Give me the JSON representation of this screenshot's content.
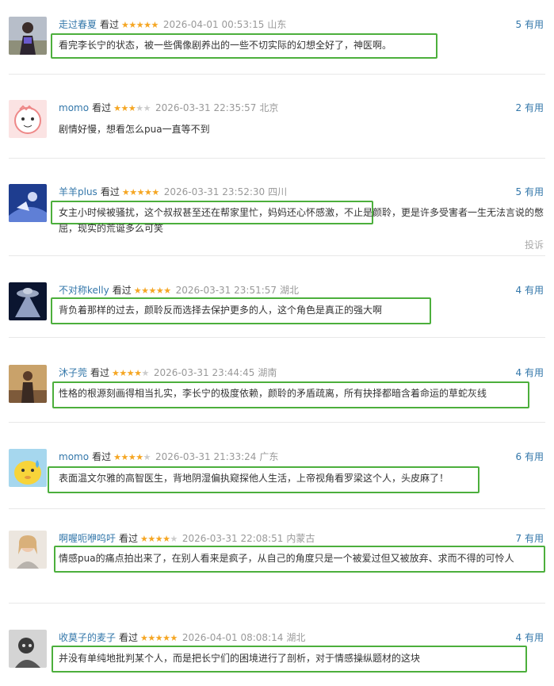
{
  "action_label": "看过",
  "useful_suffix": "有用",
  "report_label": "投诉",
  "colors": {
    "user": "#3377aa",
    "star": "#f5a623",
    "highlight": "#4caf3c",
    "meta": "#999999"
  },
  "comments": [
    {
      "user": "走过春夏",
      "rating": 5,
      "time": "2026-04-01 00:53:15",
      "location": "山东",
      "useful": "5",
      "text": "看完李长宁的状态，被一些偶像剧养出的一些不切实际的幻想全好了，神医啊。"
    },
    {
      "user": "momo",
      "rating": 3,
      "time": "2026-03-31 22:35:57",
      "location": "北京",
      "useful": "2",
      "text": "剧情好慢，想看怎么pua一直等不到"
    },
    {
      "user": "羊羊plus",
      "rating": 5,
      "time": "2026-03-31 23:52:30",
      "location": "四川",
      "useful": "5",
      "text": "女主小时候被骚扰，这个叔叔甚至还在帮家里忙，妈妈还心怀感激，不止是颜聆，更是许多受害者一生无法言说的憋屈，现实的荒诞多么可笑"
    },
    {
      "user": "不对称kelly",
      "rating": 5,
      "time": "2026-03-31 23:51:57",
      "location": "湖北",
      "useful": "4",
      "text": "背负着那样的过去，颜聆反而选择去保护更多的人，这个角色是真正的强大啊"
    },
    {
      "user": "沐子莞",
      "rating": 4,
      "time": "2026-03-31 23:44:45",
      "location": "湖南",
      "useful": "4",
      "text": "性格的根源刻画得相当扎实，李长宁的极度依赖，颜聆的矛盾疏离，所有抉择都暗含着命运的草蛇灰线"
    },
    {
      "user": "momo",
      "rating": 4,
      "time": "2026-03-31 21:33:24",
      "location": "广东",
      "useful": "6",
      "text": "表面温文尔雅的高智医生，背地阴湿偏执窥探他人生活，上帝视角看罗梁这个人，头皮麻了！"
    },
    {
      "user": "啊喔呃咿呜吁",
      "rating": 4,
      "time": "2026-03-31 22:08:51",
      "location": "内蒙古",
      "useful": "7",
      "text": "情感pua的痛点拍出来了，在别人看来是疯子，从自己的角度只是一个被爱过但又被放弃、求而不得的可怜人"
    },
    {
      "user": "收莫子的麦子",
      "rating": 5,
      "time": "2026-04-01 08:08:14",
      "location": "湖北",
      "useful": "4",
      "text": "并没有单纯地批判某个人，而是把长宁们的困境进行了剖析，对于情感操纵题材的这块"
    }
  ]
}
